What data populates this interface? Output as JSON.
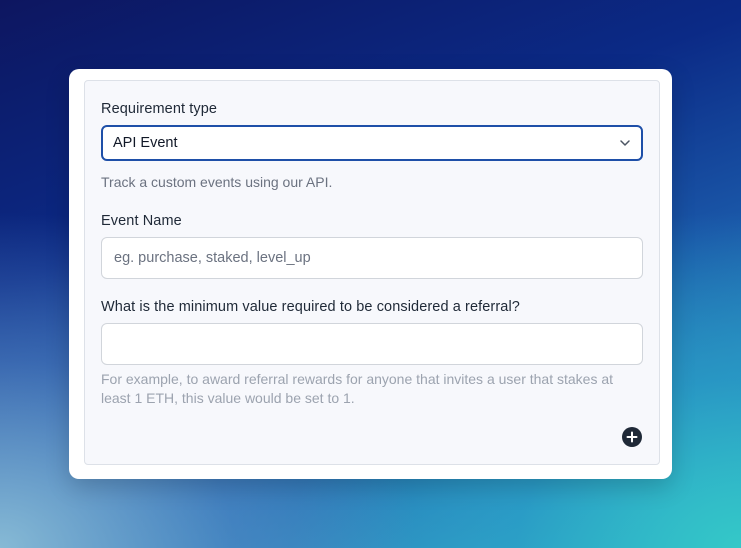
{
  "requirement": {
    "label": "Requirement type",
    "selected": "API Event",
    "description": "Track a custom events using our API."
  },
  "event_name": {
    "label": "Event Name",
    "placeholder": "eg. purchase, staked, level_up",
    "value": ""
  },
  "minimum_value": {
    "label": "What is the minimum value required to be considered a referral?",
    "placeholder": "",
    "value": "",
    "help": "For example, to award referral rewards for anyone that invites a user that stakes at least 1 ETH, this value would be set to 1."
  },
  "icons": {
    "dropdown": "chevron-down-icon",
    "add": "plus-circle-icon"
  }
}
